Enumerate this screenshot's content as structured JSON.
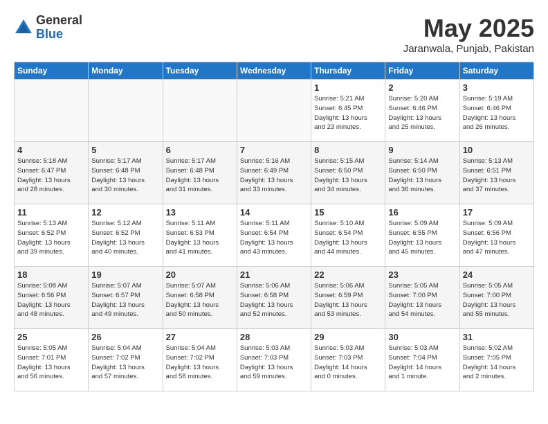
{
  "header": {
    "logo_general": "General",
    "logo_blue": "Blue",
    "month": "May 2025",
    "location": "Jaranwala, Punjab, Pakistan"
  },
  "weekdays": [
    "Sunday",
    "Monday",
    "Tuesday",
    "Wednesday",
    "Thursday",
    "Friday",
    "Saturday"
  ],
  "weeks": [
    [
      {
        "day": "",
        "content": ""
      },
      {
        "day": "",
        "content": ""
      },
      {
        "day": "",
        "content": ""
      },
      {
        "day": "",
        "content": ""
      },
      {
        "day": "1",
        "content": "Sunrise: 5:21 AM\nSunset: 6:45 PM\nDaylight: 13 hours\nand 23 minutes."
      },
      {
        "day": "2",
        "content": "Sunrise: 5:20 AM\nSunset: 6:46 PM\nDaylight: 13 hours\nand 25 minutes."
      },
      {
        "day": "3",
        "content": "Sunrise: 5:19 AM\nSunset: 6:46 PM\nDaylight: 13 hours\nand 26 minutes."
      }
    ],
    [
      {
        "day": "4",
        "content": "Sunrise: 5:18 AM\nSunset: 6:47 PM\nDaylight: 13 hours\nand 28 minutes."
      },
      {
        "day": "5",
        "content": "Sunrise: 5:17 AM\nSunset: 6:48 PM\nDaylight: 13 hours\nand 30 minutes."
      },
      {
        "day": "6",
        "content": "Sunrise: 5:17 AM\nSunset: 6:48 PM\nDaylight: 13 hours\nand 31 minutes."
      },
      {
        "day": "7",
        "content": "Sunrise: 5:16 AM\nSunset: 6:49 PM\nDaylight: 13 hours\nand 33 minutes."
      },
      {
        "day": "8",
        "content": "Sunrise: 5:15 AM\nSunset: 6:50 PM\nDaylight: 13 hours\nand 34 minutes."
      },
      {
        "day": "9",
        "content": "Sunrise: 5:14 AM\nSunset: 6:50 PM\nDaylight: 13 hours\nand 36 minutes."
      },
      {
        "day": "10",
        "content": "Sunrise: 5:13 AM\nSunset: 6:51 PM\nDaylight: 13 hours\nand 37 minutes."
      }
    ],
    [
      {
        "day": "11",
        "content": "Sunrise: 5:13 AM\nSunset: 6:52 PM\nDaylight: 13 hours\nand 39 minutes."
      },
      {
        "day": "12",
        "content": "Sunrise: 5:12 AM\nSunset: 6:52 PM\nDaylight: 13 hours\nand 40 minutes."
      },
      {
        "day": "13",
        "content": "Sunrise: 5:11 AM\nSunset: 6:53 PM\nDaylight: 13 hours\nand 41 minutes."
      },
      {
        "day": "14",
        "content": "Sunrise: 5:11 AM\nSunset: 6:54 PM\nDaylight: 13 hours\nand 43 minutes."
      },
      {
        "day": "15",
        "content": "Sunrise: 5:10 AM\nSunset: 6:54 PM\nDaylight: 13 hours\nand 44 minutes."
      },
      {
        "day": "16",
        "content": "Sunrise: 5:09 AM\nSunset: 6:55 PM\nDaylight: 13 hours\nand 45 minutes."
      },
      {
        "day": "17",
        "content": "Sunrise: 5:09 AM\nSunset: 6:56 PM\nDaylight: 13 hours\nand 47 minutes."
      }
    ],
    [
      {
        "day": "18",
        "content": "Sunrise: 5:08 AM\nSunset: 6:56 PM\nDaylight: 13 hours\nand 48 minutes."
      },
      {
        "day": "19",
        "content": "Sunrise: 5:07 AM\nSunset: 6:57 PM\nDaylight: 13 hours\nand 49 minutes."
      },
      {
        "day": "20",
        "content": "Sunrise: 5:07 AM\nSunset: 6:58 PM\nDaylight: 13 hours\nand 50 minutes."
      },
      {
        "day": "21",
        "content": "Sunrise: 5:06 AM\nSunset: 6:58 PM\nDaylight: 13 hours\nand 52 minutes."
      },
      {
        "day": "22",
        "content": "Sunrise: 5:06 AM\nSunset: 6:59 PM\nDaylight: 13 hours\nand 53 minutes."
      },
      {
        "day": "23",
        "content": "Sunrise: 5:05 AM\nSunset: 7:00 PM\nDaylight: 13 hours\nand 54 minutes."
      },
      {
        "day": "24",
        "content": "Sunrise: 5:05 AM\nSunset: 7:00 PM\nDaylight: 13 hours\nand 55 minutes."
      }
    ],
    [
      {
        "day": "25",
        "content": "Sunrise: 5:05 AM\nSunset: 7:01 PM\nDaylight: 13 hours\nand 56 minutes."
      },
      {
        "day": "26",
        "content": "Sunrise: 5:04 AM\nSunset: 7:02 PM\nDaylight: 13 hours\nand 57 minutes."
      },
      {
        "day": "27",
        "content": "Sunrise: 5:04 AM\nSunset: 7:02 PM\nDaylight: 13 hours\nand 58 minutes."
      },
      {
        "day": "28",
        "content": "Sunrise: 5:03 AM\nSunset: 7:03 PM\nDaylight: 13 hours\nand 59 minutes."
      },
      {
        "day": "29",
        "content": "Sunrise: 5:03 AM\nSunset: 7:03 PM\nDaylight: 14 hours\nand 0 minutes."
      },
      {
        "day": "30",
        "content": "Sunrise: 5:03 AM\nSunset: 7:04 PM\nDaylight: 14 hours\nand 1 minute."
      },
      {
        "day": "31",
        "content": "Sunrise: 5:02 AM\nSunset: 7:05 PM\nDaylight: 14 hours\nand 2 minutes."
      }
    ]
  ]
}
